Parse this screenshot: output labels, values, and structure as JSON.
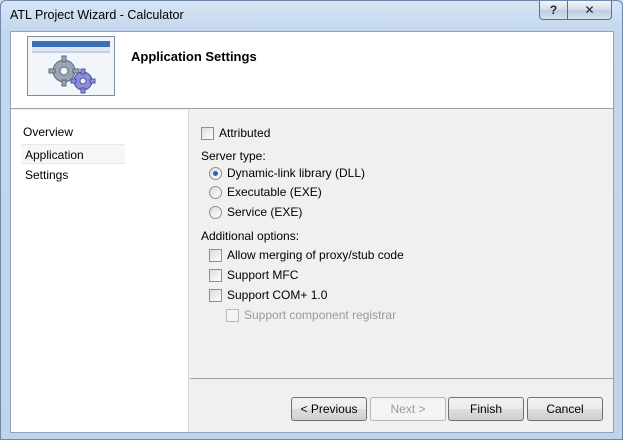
{
  "window": {
    "title": "ATL Project Wizard - Calculator"
  },
  "caption": {
    "help": "?",
    "close": "✕"
  },
  "header": {
    "title": "Application Settings"
  },
  "nav": {
    "items": [
      "Overview",
      "Application Settings"
    ]
  },
  "options": {
    "attributed": {
      "label": "Attributed",
      "checked": false
    },
    "server_type": {
      "label": "Server type:",
      "choices": [
        {
          "label": "Dynamic-link library (DLL)",
          "checked": true
        },
        {
          "label": "Executable (EXE)",
          "checked": false
        },
        {
          "label": "Service (EXE)",
          "checked": false
        }
      ]
    },
    "additional": {
      "label": "Additional options:",
      "items": [
        {
          "label": "Allow merging of proxy/stub code",
          "checked": false,
          "enabled": true
        },
        {
          "label": "Support MFC",
          "checked": false,
          "enabled": true
        },
        {
          "label": "Support COM+ 1.0",
          "checked": false,
          "enabled": true
        },
        {
          "label": "Support component registrar",
          "checked": false,
          "enabled": false
        }
      ]
    }
  },
  "buttons": {
    "previous": "< Previous",
    "next": "Next >",
    "finish": "Finish",
    "cancel": "Cancel"
  }
}
